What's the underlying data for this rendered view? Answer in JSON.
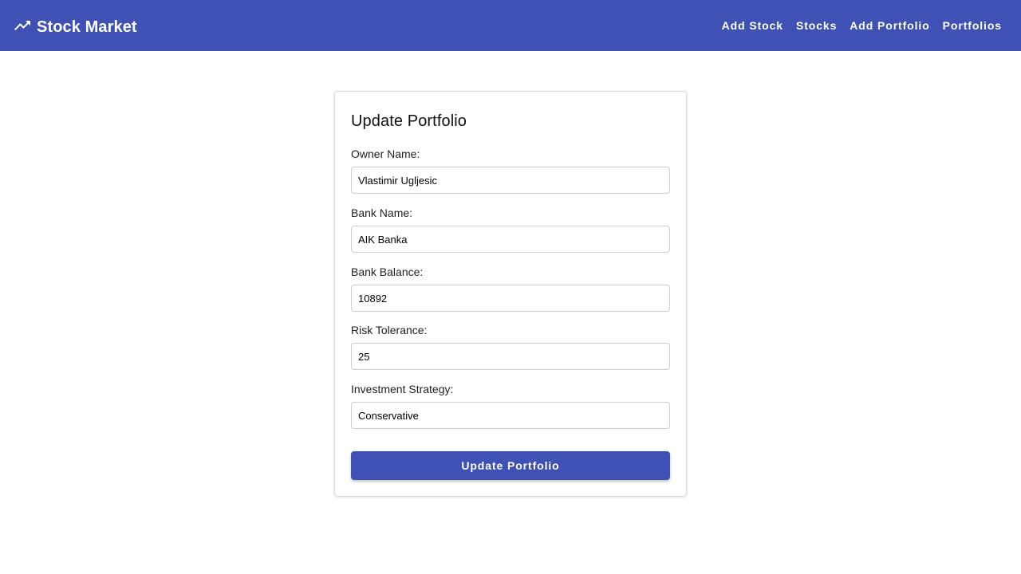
{
  "app": {
    "title": "Stock Market",
    "logo_icon": "trending-up-icon",
    "brand_color": "#3f51b5"
  },
  "nav": {
    "items": [
      {
        "label": "Add Stock"
      },
      {
        "label": "Stocks"
      },
      {
        "label": "Add Portfolio"
      },
      {
        "label": "Portfolios"
      }
    ]
  },
  "form": {
    "title": "Update Portfolio",
    "fields": [
      {
        "label": "Owner Name:",
        "value": "Vlastimir Ugljesic"
      },
      {
        "label": "Bank Name:",
        "value": "AIK Banka"
      },
      {
        "label": "Bank Balance:",
        "value": "10892"
      },
      {
        "label": "Risk Tolerance:",
        "value": "25"
      },
      {
        "label": "Investment Strategy:",
        "value": "Conservative"
      }
    ],
    "submit_label": "Update Portfolio"
  }
}
